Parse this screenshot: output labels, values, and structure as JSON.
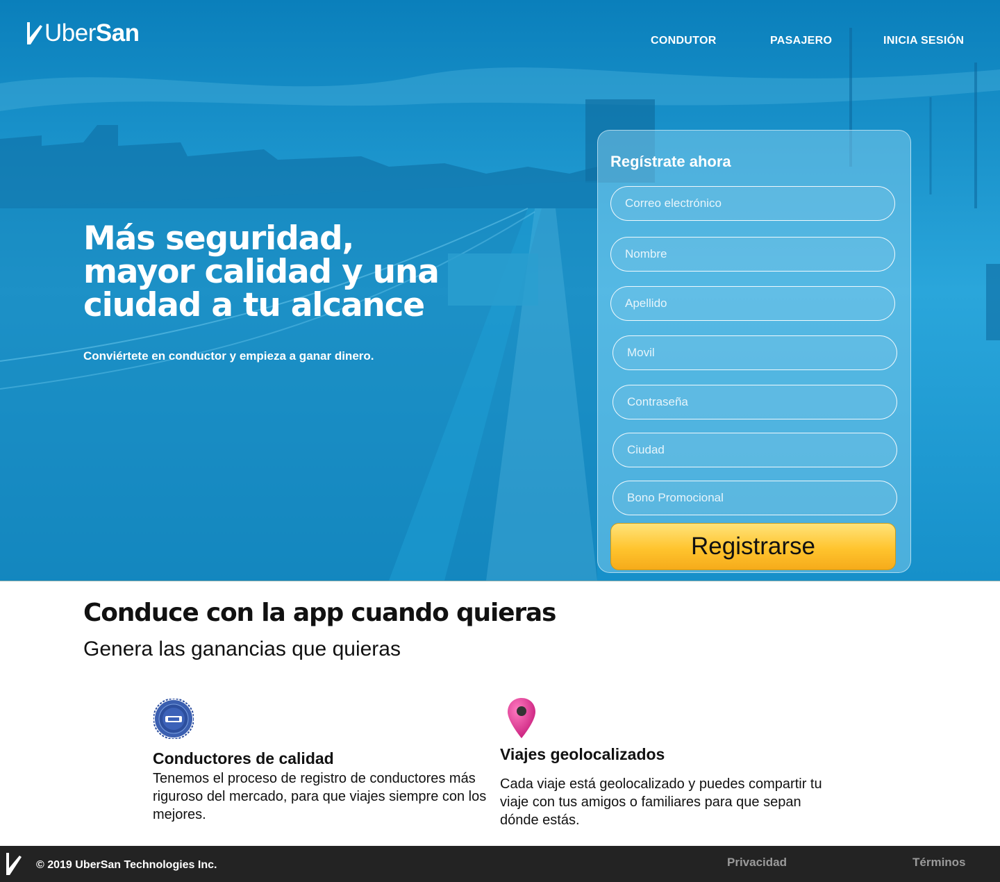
{
  "brand": {
    "name_light": "Uber",
    "name_bold": "San",
    "primary_color": "#1a95cf",
    "accent_color": "#ffc42e"
  },
  "nav": {
    "conductor": "CONDUTOR",
    "pasajero": "PASAJERO",
    "login": "INICIA SESIÓN"
  },
  "hero": {
    "headline": "Más seguridad, mayor calidad y una ciudad a tu alcance",
    "subline": "Conviértete en conductor y empieza a ganar dinero."
  },
  "form": {
    "title": "Regístrate ahora",
    "email_placeholder": "Correo electrónico",
    "name_placeholder": "Nombre",
    "lastname_placeholder": "Apellido",
    "mobile_placeholder": "Movil",
    "password_placeholder": "Contraseña",
    "city_placeholder": "Ciudad",
    "promo_placeholder": "Bono Promocional",
    "submit_label": "Registrarse"
  },
  "section": {
    "title": "Conduce con la app cuando quieras",
    "subtitle": "Genera las ganancias que quieras"
  },
  "features": [
    {
      "icon": "quality-badge-icon",
      "title": "Conductores de calidad",
      "text": "Tenemos el proceso de registro de conductores más riguroso del mercado, para que viajes siempre con los mejores."
    },
    {
      "icon": "map-pin-icon",
      "title": "Viajes geolocalizados",
      "text": "Cada viaje está geolocalizado y puedes compartir tu viaje con tus amigos o familiares para que sepan dónde estás."
    }
  ],
  "footer": {
    "copyright": "© 2019 UberSan Technologies Inc.",
    "privacy": "Privacidad",
    "terms": "Términos"
  }
}
